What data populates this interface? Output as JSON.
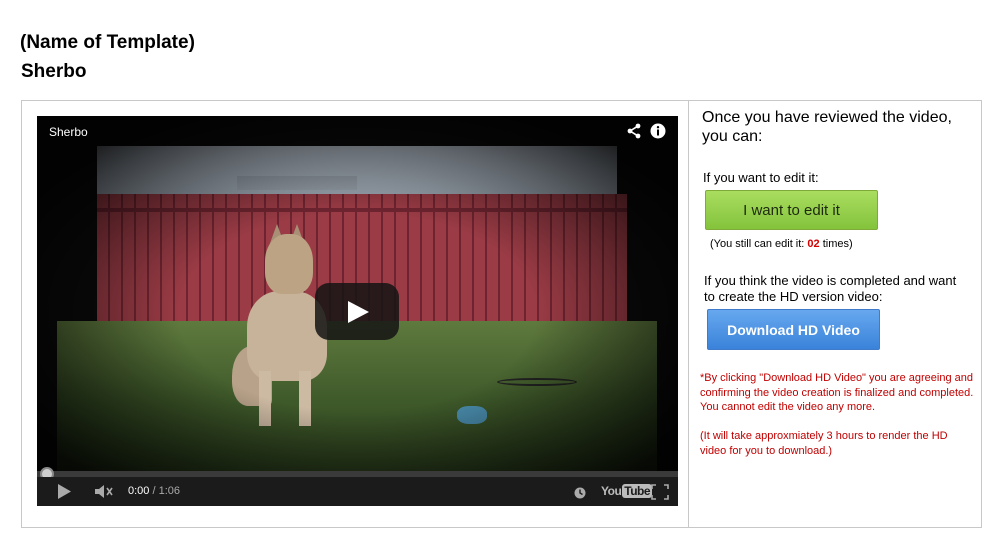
{
  "header": {
    "template_label": "(Name of Template)",
    "template_name": "Sherbo"
  },
  "player": {
    "video_title": "Sherbo",
    "current_time": "0:00",
    "time_separator": " / ",
    "duration": "1:06",
    "progress_fraction": 0.0,
    "brand_left": "You",
    "brand_right": "Tube"
  },
  "panel": {
    "intro": "Once you have reviewed the video, you can:",
    "edit_label": "If you want to edit it:",
    "edit_button": "I want to edit it",
    "edit_note_prefix": "(You still can edit it: ",
    "edit_count": "02",
    "edit_note_suffix": " times)",
    "hd_label": "If you think the video is completed and want to create the HD version video:",
    "hd_button": "Download HD Video",
    "warning": "*By clicking \"Download HD Video\" you are agreeing and confirming the video creation is finalized and completed. You cannot edit the video any more.",
    "render_note": "(It will take approxmiately 3 hours to render the HD video for you to download.)"
  },
  "colors": {
    "edit_button": "#95cf4c",
    "hd_button": "#4b93e3",
    "warning_text": "#c00000",
    "count_text": "#d50000"
  },
  "icons": [
    "share-icon",
    "info-icon",
    "play-icon",
    "volume-icon",
    "clock-icon",
    "fullscreen-icon"
  ]
}
